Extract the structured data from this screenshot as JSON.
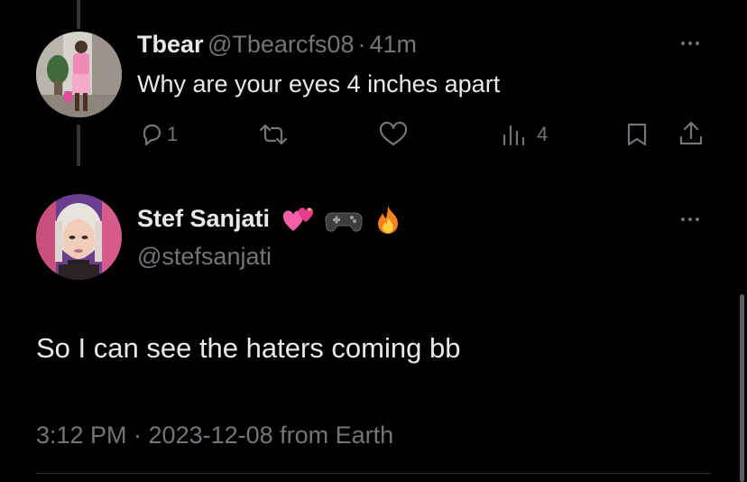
{
  "reply": {
    "display_name": "Tbear",
    "handle": "@Tbearcfs08",
    "separator": "·",
    "time_ago": "41m",
    "text": "Why are your eyes 4 inches apart",
    "reply_count": "1",
    "view_count": "4",
    "icons": [
      "reply-icon",
      "retweet-icon",
      "like-icon",
      "views-icon",
      "bookmark-icon",
      "share-icon",
      "more-icon"
    ]
  },
  "main_tweet": {
    "display_name": "Stef Sanjati",
    "name_emojis": [
      "heart-emoji",
      "game-controller-emoji",
      "fire-emoji"
    ],
    "handle": "@stefsanjati",
    "text": "So I can see the haters coming bb",
    "timestamp": "3:12 PM · 2023-12-08 from Earth"
  },
  "colors": {
    "background": "#000000",
    "primary_text": "#e7e9ea",
    "secondary_text": "#71767b",
    "thread_line": "#333639",
    "divider": "#2f3336"
  }
}
